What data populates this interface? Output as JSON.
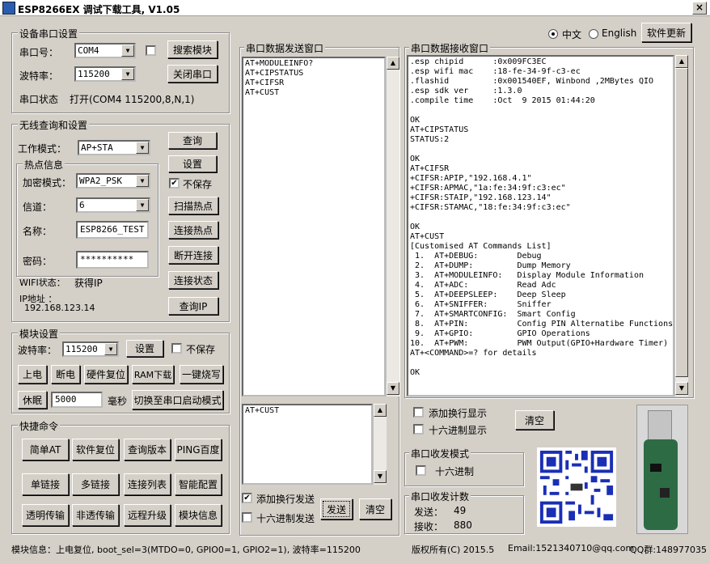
{
  "window": {
    "title": "ESP8266EX 调试下载工具, V1.05",
    "close": "×"
  },
  "lang": {
    "zh": "中文",
    "en": "English",
    "update_btn": "软件更新"
  },
  "serial": {
    "group": "设备串口设置",
    "port_label": "串口号：",
    "port_value": "COM4",
    "search_btn": "搜索模块",
    "baud_label": "波特率：",
    "baud_value": "115200",
    "close_btn": "关闭串口",
    "status_label": "串口状态",
    "status_value": "打开(COM4 115200,8,N,1)"
  },
  "wifi": {
    "group": "无线查询和设置",
    "mode_label": "工作模式：",
    "mode_value": "AP+STA",
    "query_btn": "查询",
    "set_btn": "设置",
    "nosave": "不保存",
    "hotspot_group": "热点信息",
    "enc_label": "加密模式：",
    "enc_value": "WPA2_PSK",
    "chan_label": "信道：",
    "chan_value": "6",
    "name_label": "名称：",
    "name_value": "ESP8266_TEST",
    "pwd_label": "密码：",
    "pwd_value": "**********",
    "scan_btn": "扫描热点",
    "connect_btn": "连接热点",
    "disconnect_btn": "断开连接",
    "state_btn": "连接状态",
    "queryip_btn": "查询IP",
    "wifi_status_label": "WIFI状态：",
    "wifi_status_value": "获得IP",
    "ip_label": "IP地址 ：",
    "ip_value": "192.168.123.14"
  },
  "module": {
    "group": "模块设置",
    "baud_label": "波特率：",
    "baud_value": "115200",
    "set_btn": "设置",
    "nosave": "不保存",
    "power_on": "上电",
    "power_off": "断电",
    "hw_reset": "硬件复位",
    "ram_dl": "RAM下载",
    "flash": "一键烧写",
    "sleep_btn": "休眠",
    "sleep_value": "5000",
    "ms": "毫秒",
    "switch_btn": "切换至串口启动模式"
  },
  "quick": {
    "group": "快捷命令",
    "buttons": [
      "简单AT",
      "软件复位",
      "查询版本",
      "PING百度",
      "单链接",
      "多链接",
      "连接列表",
      "智能配置",
      "透明传输",
      "非透传输",
      "远程升级",
      "模块信息"
    ]
  },
  "send": {
    "group": "串口数据发送窗口",
    "text": "AT+MODULEINFO?\nAT+CIPSTATUS\nAT+CIFSR\nAT+CUST",
    "input": "AT+CUST",
    "newline": "添加换行发送",
    "hex": "十六进制发送",
    "send_btn": "发送",
    "clear_btn": "清空"
  },
  "recv": {
    "group": "串口数据接收窗口",
    "text": ".esp chipid      :0x009FC3EC\n.esp wifi mac    :18-fe-34-9f-c3-ec\n.flashid         :0x001540EF, Winbond ,2MBytes QIO\n.esp sdk ver     :1.3.0\n.compile time    :Oct  9 2015 01:44:20\n\nOK\nAT+CIPSTATUS\nSTATUS:2\n\nOK\nAT+CIFSR\n+CIFSR:APIP,\"192.168.4.1\"\n+CIFSR:APMAC,\"1a:fe:34:9f:c3:ec\"\n+CIFSR:STAIP,\"192.168.123.14\"\n+CIFSR:STAMAC,\"18:fe:34:9f:c3:ec\"\n\nOK\nAT+CUST\n[Customised AT Commands List]\n 1.  AT+DEBUG:        Debug\n 2.  AT+DUMP:         Dump Memory\n 3.  AT+MODULEINFO:   Display Module Information\n 4.  AT+ADC:          Read Adc\n 5.  AT+DEEPSLEEP:    Deep Sleep\n 6.  AT+SNIFFER:      Sniffer\n 7.  AT+SMARTCONFIG:  Smart Config\n 8.  AT+PIN:          Config PIN Alternatibe Functions\n 9.  AT+GPIO:         GPIO Operations\n10.  AT+PWM:          PWM Output(GPIO+Hardware Timer)\nAT+<COMMAND>=? for details\n\nOK",
    "newline": "添加换行显示",
    "hex": "十六进制显示",
    "clear_btn": "清空"
  },
  "mode": {
    "group": "串口收发模式",
    "hex": "十六进制"
  },
  "count": {
    "group": "串口收发计数",
    "send_label": "发送：",
    "send_value": "49",
    "recv_label": "接收：",
    "recv_value": "880"
  },
  "status": {
    "module_info": "模块信息：上电复位, boot_sel=3(MTDO=0, GPIO0=1, GPIO2=1), 波特率=115200",
    "copyright": "版权所有(C) 2015.5",
    "email": "Email:1521340710@qq.com",
    "qq": "QQ群:148977035"
  }
}
